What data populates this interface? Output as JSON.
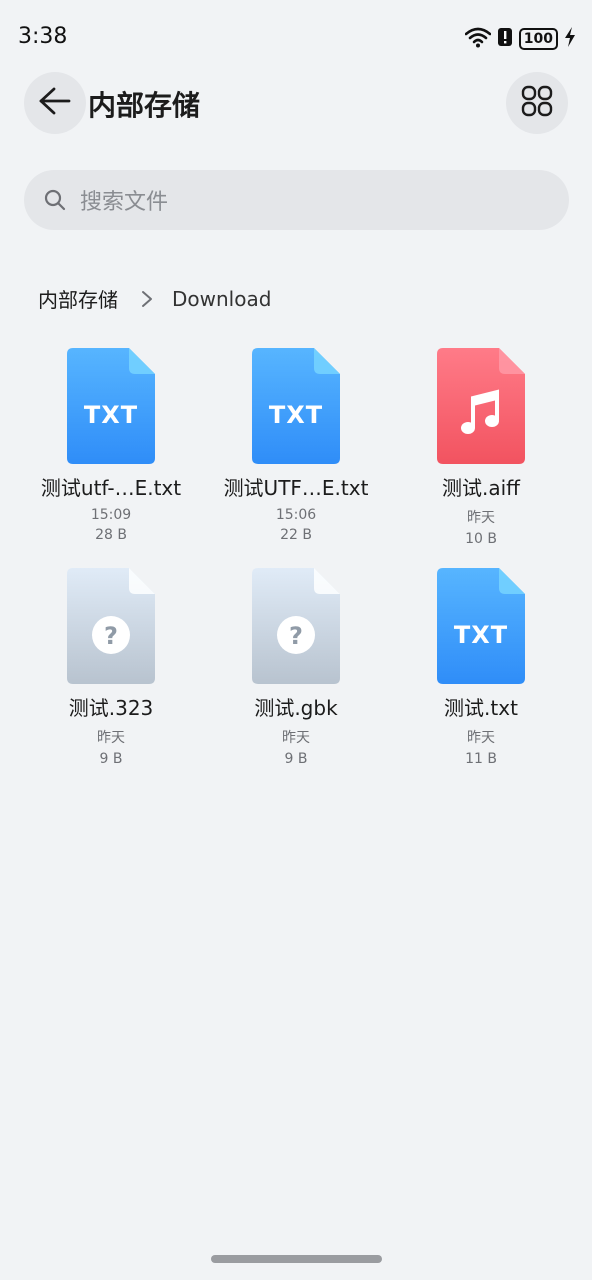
{
  "status_bar": {
    "time": "3:38",
    "battery": "100",
    "icons": [
      "wifi-icon",
      "alert-icon",
      "battery-icon",
      "charging-icon"
    ]
  },
  "header": {
    "title": "内部存储",
    "back_icon": "back-arrow-icon",
    "view_icon": "grid-view-icon"
  },
  "search": {
    "placeholder": "搜索文件",
    "icon": "search-icon"
  },
  "breadcrumb": {
    "root": "内部存储",
    "current": "Download"
  },
  "files": [
    {
      "name": "测试utf-…E.txt",
      "date": "15:09",
      "size": "28 B",
      "type": "txt",
      "badge": "TXT",
      "color": "#2f8df8"
    },
    {
      "name": "测试UTF…E.txt",
      "date": "15:06",
      "size": "22 B",
      "type": "txt",
      "badge": "TXT",
      "color": "#2f8df8"
    },
    {
      "name": "测试.aiff",
      "date": "昨天",
      "size": "10 B",
      "type": "audio",
      "badge": "",
      "color": "#f25360"
    },
    {
      "name": "测试.323",
      "date": "昨天",
      "size": "9 B",
      "type": "unknown",
      "badge": "",
      "color": "#b8c3cf"
    },
    {
      "name": "测试.gbk",
      "date": "昨天",
      "size": "9 B",
      "type": "unknown",
      "badge": "",
      "color": "#b8c3cf"
    },
    {
      "name": "测试.txt",
      "date": "昨天",
      "size": "11 B",
      "type": "txt",
      "badge": "TXT",
      "color": "#2f8df8"
    }
  ]
}
